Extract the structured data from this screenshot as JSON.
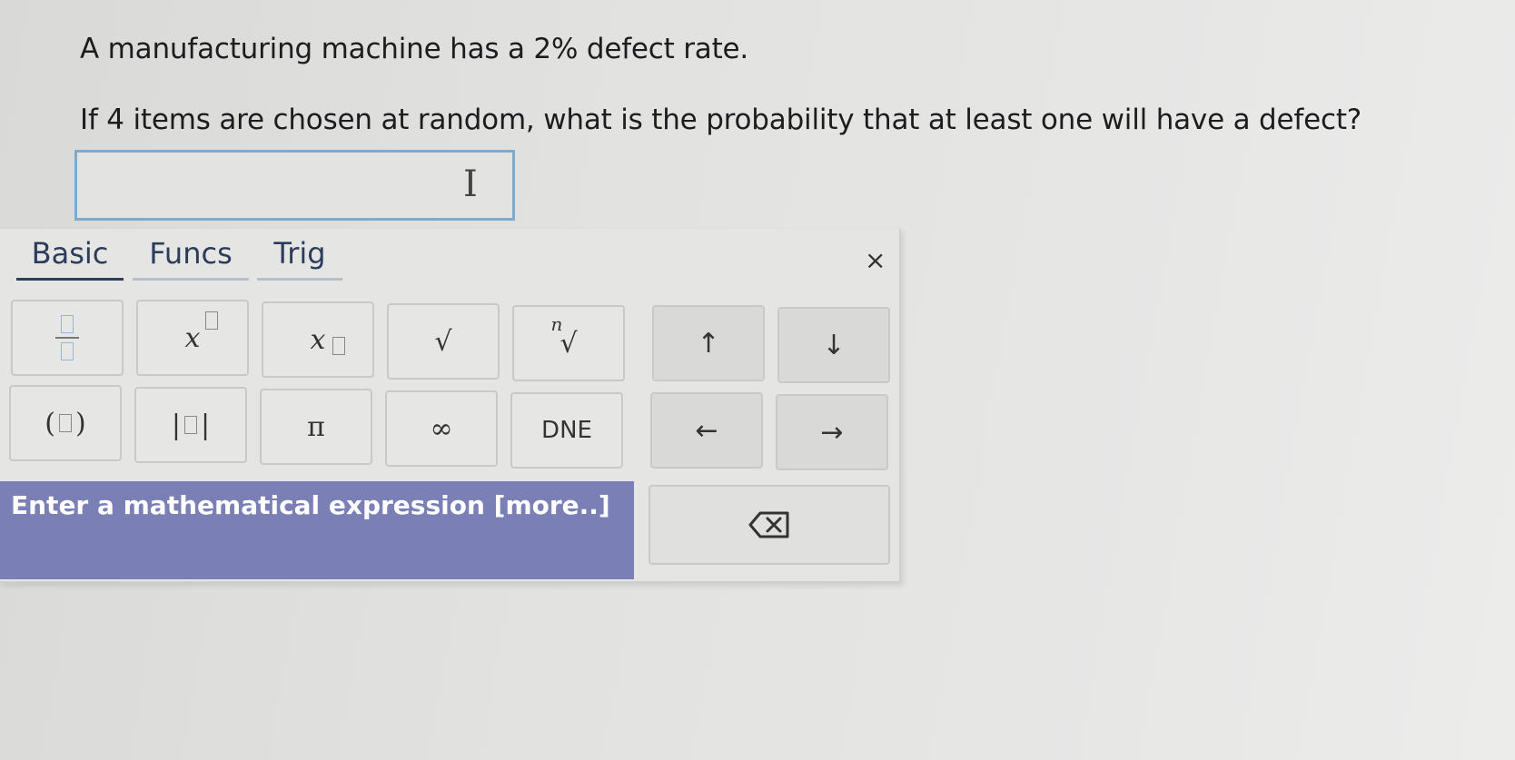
{
  "question": {
    "line1": "A manufacturing machine has a 2% defect rate.",
    "line2": "If 4 items are chosen at random, what is the probability that at least one will have a defect?"
  },
  "answer": {
    "value": ""
  },
  "palette": {
    "tabs": {
      "basic": "Basic",
      "funcs": "Funcs",
      "trig": "Trig",
      "active": "Basic"
    },
    "close_label": "×",
    "keys": {
      "x": "x",
      "n": "n",
      "sqrt": "√",
      "pi": "π",
      "infinity": "∞",
      "dne": "DNE",
      "up": "↑",
      "down": "↓",
      "left": "←",
      "right": "→",
      "paren_open": "(",
      "paren_close": ")",
      "abs_bar": "|"
    },
    "help_text": "Enter a mathematical expression [more..]"
  }
}
